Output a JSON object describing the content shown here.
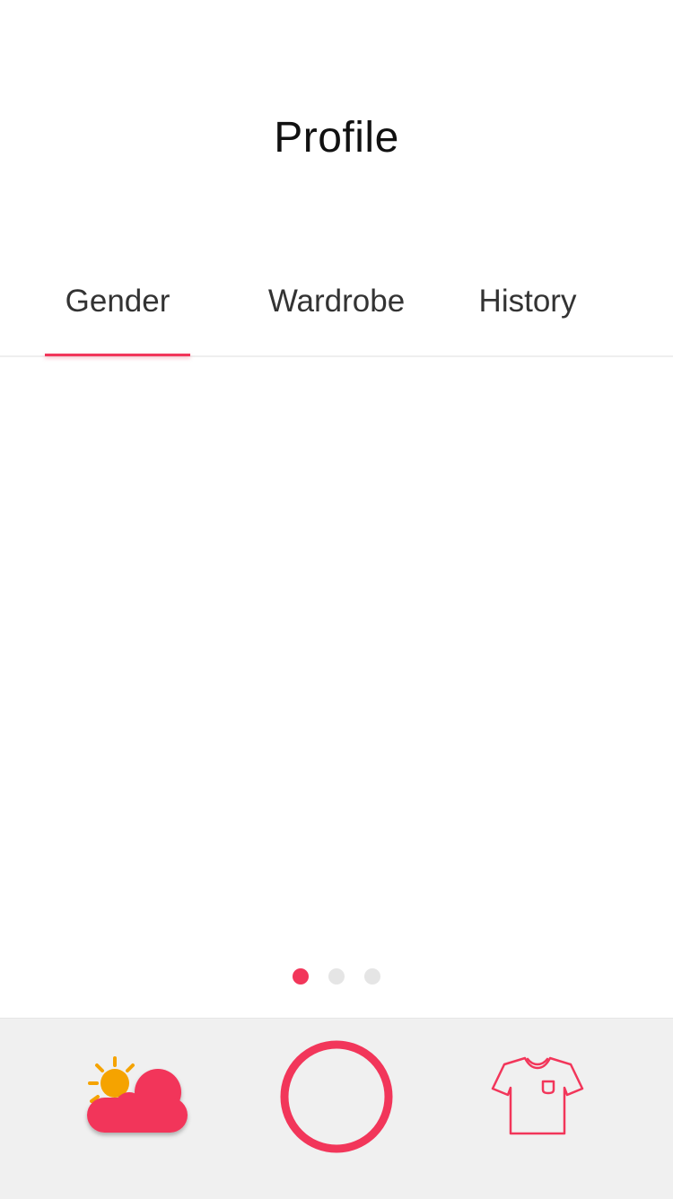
{
  "header": {
    "title": "Profile"
  },
  "tabs": [
    {
      "label": "Gender",
      "selected": true
    },
    {
      "label": "Wardrobe",
      "selected": false
    },
    {
      "label": "History",
      "selected": false
    }
  ],
  "pager": {
    "count": 3,
    "current": 1
  },
  "bottom_nav": {
    "items": [
      {
        "icon": "weather-icon"
      },
      {
        "icon": "capture-ring-icon"
      },
      {
        "icon": "tshirt-icon"
      }
    ]
  },
  "colors": {
    "accent": "#f2365a",
    "sun": "#f5a300",
    "bar_background": "#f0f0f0",
    "dot_inactive": "#e5e5e5"
  }
}
